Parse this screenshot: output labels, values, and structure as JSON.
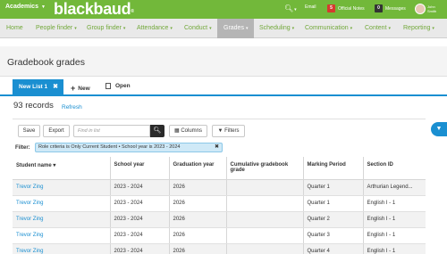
{
  "topbar": {
    "module": "Academics",
    "logo": "blackbaud",
    "email_label": "Email",
    "official_notes_count": "5",
    "official_notes_label": "Official Notes",
    "messages_count": "0",
    "messages_label": "Messages",
    "user_first": "John",
    "user_last": "Smith"
  },
  "nav": [
    "Home",
    "People finder",
    "Group finder",
    "Attendance",
    "Conduct",
    "Grades",
    "Scheduling",
    "Communication",
    "Content",
    "Reporting"
  ],
  "page": {
    "title": "Gradebook grades",
    "tab_active": "New List 1",
    "tab_new": "New",
    "tab_open": "Open",
    "record_count": "93 records",
    "refresh": "Refresh"
  },
  "toolbar": {
    "save": "Save",
    "export": "Export",
    "find_placeholder": "Find in list",
    "columns": "Columns",
    "filters": "Filters"
  },
  "filter": {
    "label": "Filter:",
    "criteria": "Role criteria is Only Current Student • School year is 2023 - 2024"
  },
  "table": {
    "headers": [
      "Student name ▾",
      "School year",
      "Graduation year",
      "Cumulative gradebook grade",
      "Marking Period",
      "Section ID"
    ],
    "rows": [
      [
        "Trevor Zing",
        "2023 - 2024",
        "2026",
        "",
        "Quarter 1",
        "Arthurian Legend..."
      ],
      [
        "Trevor Zing",
        "2023 - 2024",
        "2026",
        "",
        "Quarter 1",
        "English I - 1"
      ],
      [
        "Trevor Zing",
        "2023 - 2024",
        "2026",
        "",
        "Quarter 2",
        "English I - 1"
      ],
      [
        "Trevor Zing",
        "2023 - 2024",
        "2026",
        "",
        "Quarter 3",
        "English I - 1"
      ],
      [
        "Trevor Zing",
        "2023 - 2024",
        "2026",
        "",
        "Quarter 4",
        "English I - 1"
      ]
    ]
  },
  "colors": {
    "brand_green": "#72b83a",
    "accent_blue": "#1a8fd1"
  }
}
